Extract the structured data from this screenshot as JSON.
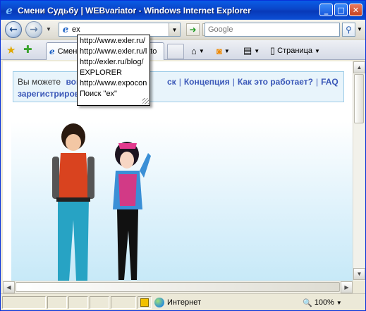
{
  "window": {
    "title": "Смени Судьбу | WEBvariator - Windows Internet Explorer"
  },
  "toolbar": {
    "address_value": "ex",
    "search_placeholder": "Google"
  },
  "tabs": [
    {
      "label": "Смени Судьбу | WEBvariator"
    }
  ],
  "commands": {
    "page_label": "Страница"
  },
  "autocomplete": {
    "items": [
      "http://www.exler.ru/",
      "http://www.exler.ru/lator",
      "http://exler.ru/blog/",
      "EXPLORER",
      "http://www.expocon",
      "Поиск \"ex\""
    ]
  },
  "page": {
    "info_prefix": "Вы можете",
    "login_link": "войти",
    "register_link": "зарегистрирова",
    "nav_links": [
      "ск",
      "Концепция",
      "Как это работает?",
      "FAQ"
    ]
  },
  "status": {
    "zone_label": "Интернет",
    "zoom_label": "100%"
  },
  "colors": {
    "titlebar": "#0a45c8",
    "link": "#3b58b8",
    "infobar_bg": "#e8f4fb"
  }
}
